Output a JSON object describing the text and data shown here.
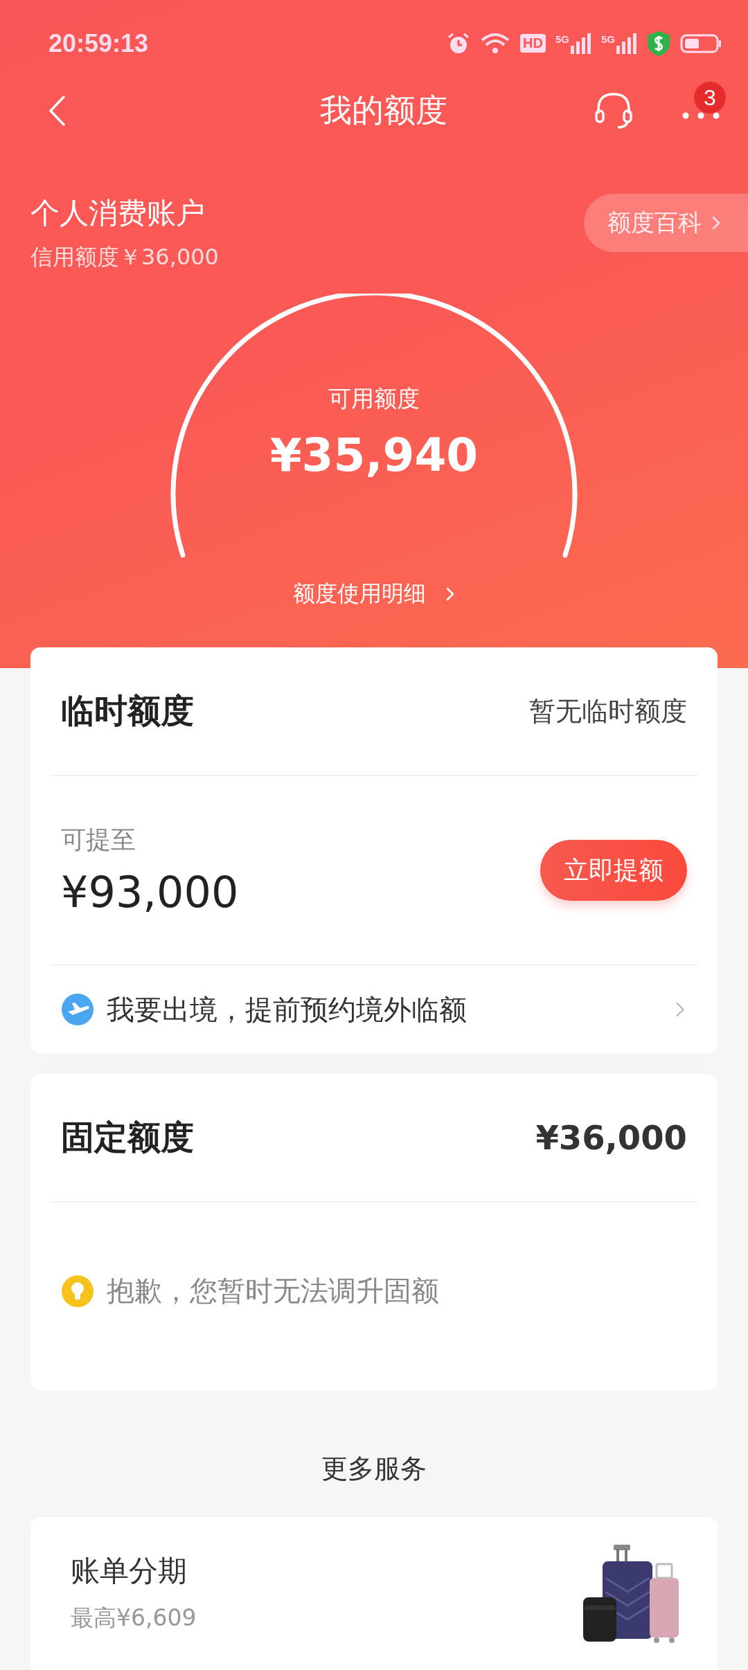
{
  "status_bar": {
    "time": "20:59:13",
    "hd_label": "HD",
    "sim_labels": [
      "5G",
      "5G"
    ]
  },
  "header": {
    "title": "我的额度",
    "badge": "3"
  },
  "account": {
    "name": "个人消费账户",
    "credit_line": "信用额度￥36,000",
    "wiki_link": "额度百科"
  },
  "gauge": {
    "label": "可用额度",
    "amount": "¥35,940",
    "detail_link": "额度使用明细"
  },
  "temporary_card": {
    "title": "临时额度",
    "status": "暂无临时额度",
    "raise_label": "可提至",
    "raise_amount": "¥93,000",
    "button": "立即提额",
    "promo": "我要出境，提前预约境外临额"
  },
  "fixed_card": {
    "title": "固定额度",
    "amount": "¥36,000",
    "notice": "抱歉，您暂时无法调升固额"
  },
  "more_services": {
    "title": "更多服务",
    "items": [
      {
        "title": "账单分期",
        "subtitle": "最高¥6,609",
        "kind": "picture"
      }
    ]
  }
}
